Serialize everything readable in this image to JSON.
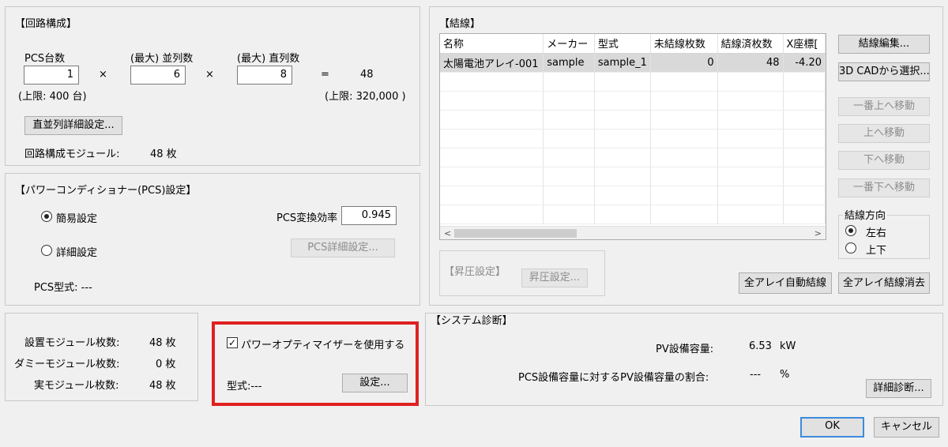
{
  "circuit": {
    "title": "【回路構成】",
    "pcs_count_label": "PCS台数",
    "pcs_count_value": "1",
    "parallel_label": "(最大) 並列数",
    "parallel_value": "6",
    "series_label": "(最大) 直列数",
    "series_value": "8",
    "times1": "×",
    "times2": "×",
    "equals": "=",
    "result": "48",
    "pcs_limit": "(上限: 400 台)",
    "result_limit": "(上限: 320,000 )",
    "detail_button": "直並列詳細設定...",
    "module_label": "回路構成モジュール:",
    "module_value": "48 枚"
  },
  "pcs": {
    "title": "【パワーコンディショナー(PCS)設定】",
    "simple_label": "簡易設定",
    "detail_label": "詳細設定",
    "efficiency_label": "PCS変換効率",
    "efficiency_value": "0.945",
    "detail_button": "PCS詳細設定...",
    "model_label": "PCS型式: ---"
  },
  "modules": {
    "installed_label": "設置モジュール枚数:",
    "installed_value": "48 枚",
    "dummy_label": "ダミーモジュール枚数:",
    "dummy_value": "0 枚",
    "real_label": "実モジュール枚数:",
    "real_value": "48 枚"
  },
  "optimizer": {
    "checkbox_label": "パワーオプティマイザーを使用する",
    "checkmark": "✓",
    "model_label": "型式:---",
    "settings_button": "設定..."
  },
  "wiring": {
    "title": "【結線】",
    "columns": [
      "名称",
      "メーカー",
      "型式",
      "未結線枚数",
      "結線済枚数",
      "X座標["
    ],
    "rows": [
      [
        "太陽電池アレイ-001",
        "sample",
        "sample_1",
        "0",
        "48",
        "-4.20"
      ]
    ],
    "scroll_left": "<",
    "scroll_right": ">",
    "edit_button": "結線編集...",
    "cad_button": "3D CADから選択...",
    "top_button": "一番上へ移動",
    "up_button": "上へ移動",
    "down_button": "下へ移動",
    "bottom_button": "一番下へ移動",
    "direction_label": "結線方向",
    "direction_lr": "左右",
    "direction_ud": "上下",
    "boost_title": "【昇圧設定】",
    "boost_button": "昇圧設定...",
    "auto_button": "全アレイ自動結線",
    "clear_button": "全アレイ結線消去"
  },
  "diagnosis": {
    "title": "【システム診断】",
    "pv_label": "PV設備容量:",
    "pv_value": "6.53",
    "pv_unit": "kW",
    "ratio_label": "PCS設備容量に対するPV設備容量の割合:",
    "ratio_value": "---",
    "ratio_unit": "%",
    "detail_button": "詳細診断..."
  },
  "dialog": {
    "ok": "OK",
    "cancel": "キャンセル"
  }
}
